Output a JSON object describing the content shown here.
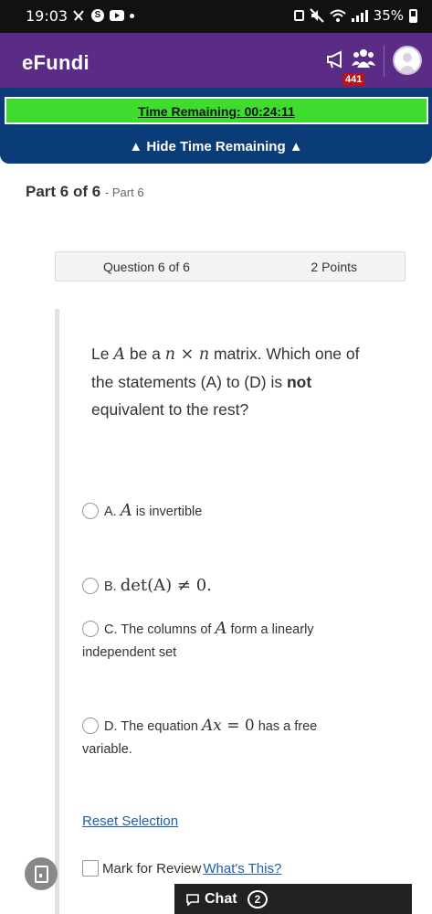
{
  "status_bar": {
    "time": "19:03",
    "battery": "35%"
  },
  "app": {
    "name": "eFundi",
    "notification_count": "441"
  },
  "timer": {
    "label": "Time Remaining: 00:24:11",
    "toggle_label": "▲ Hide Time Remaining ▲"
  },
  "part": {
    "title": "Part 6 of 6",
    "subtitle": "- Part 6"
  },
  "question": {
    "number_label": "Question 6 of 6",
    "points_label": "2 Points",
    "text_pre": "Le ",
    "text_A": "A",
    "text_mid1": " be a ",
    "text_n1": "n",
    "text_times": " × ",
    "text_n2": "n",
    "text_mid2": " matrix. Which one of the statements (A) to (D) is ",
    "text_bold": "not",
    "text_post": " equivalent to the rest?"
  },
  "options": [
    {
      "letter": "A.",
      "math": "A",
      "text": " is invertible"
    },
    {
      "letter": "B.",
      "math": "det(A) ≠ 0."
    },
    {
      "letter": "C.",
      "pre": "The columns of ",
      "math": "A",
      "text": " form a linearly independent set"
    },
    {
      "letter": "D.",
      "pre": "The equation ",
      "math": "Ax",
      "eq": " = 0",
      "text": " has a free variable."
    }
  ],
  "actions": {
    "reset_label": "Reset Selection",
    "mark_label": "Mark for Review",
    "whats_this": "What's This?"
  },
  "chat": {
    "label": "Chat",
    "count": "2"
  },
  "colors": {
    "header_purple": "#5b2c86",
    "timer_blue": "#0a3d78",
    "timer_green": "#3ddc2e"
  },
  "icons": [
    "alarm-icon",
    "s-circle-icon",
    "youtube-icon",
    "lock-icon",
    "mute-icon",
    "wifi-icon",
    "signal-icon",
    "battery-icon",
    "megaphone-icon",
    "people-icon",
    "avatar-icon",
    "chat-bubble-icon",
    "device-icon"
  ]
}
